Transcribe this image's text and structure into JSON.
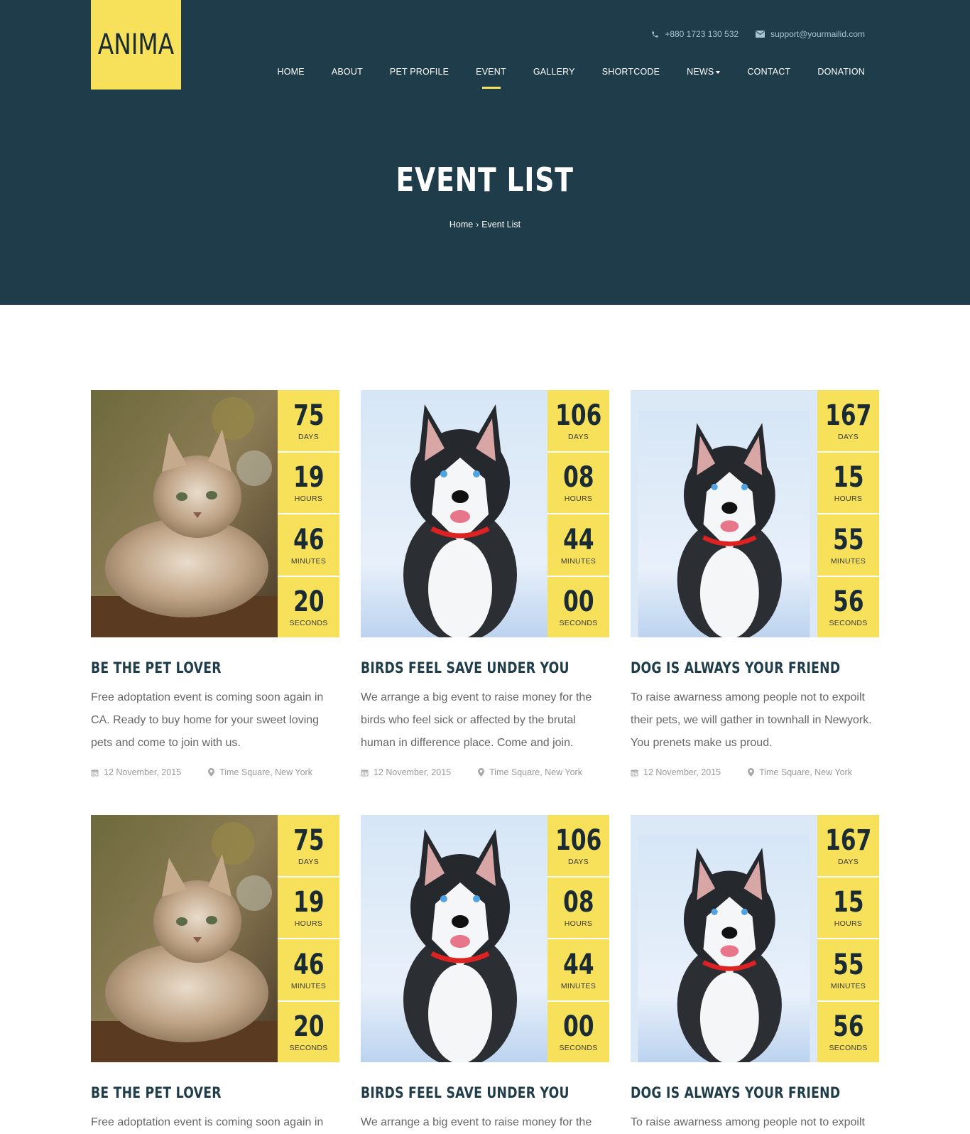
{
  "brand": {
    "logo_text": "ANIMA"
  },
  "contact": {
    "phone": "+880 1723 130 532",
    "email": "support@yourmailid.com"
  },
  "nav": {
    "items": [
      {
        "label": "HOME"
      },
      {
        "label": "ABOUT"
      },
      {
        "label": "PET PROFILE"
      },
      {
        "label": "EVENT",
        "active": true
      },
      {
        "label": "GALLERY"
      },
      {
        "label": "SHORTCODE"
      },
      {
        "label": "NEWS",
        "dropdown": true
      },
      {
        "label": "CONTACT"
      },
      {
        "label": "DONATION"
      }
    ]
  },
  "hero": {
    "title": "EVENT LIST",
    "breadcrumb": [
      "Home",
      "Event List"
    ]
  },
  "countdown_labels": {
    "days": "DAYS",
    "hours": "HOURS",
    "minutes": "MINUTES",
    "seconds": "SECONDS"
  },
  "events": [
    {
      "image": "cat-photo",
      "days": "75",
      "hours": "19",
      "minutes": "46",
      "seconds": "20",
      "title": "BE THE PET LOVER",
      "description": "Free adoptation event is coming soon again in CA. Ready to buy home for your sweet loving pets and come to join with us.",
      "date": "12 November, 2015",
      "location": "Time Square, New York"
    },
    {
      "image": "husky-puppy-photo",
      "days": "106",
      "hours": "08",
      "minutes": "44",
      "seconds": "00",
      "title": "BIRDS FEEL SAVE UNDER YOU",
      "description": "We arrange a big event to raise money for the birds who feel sick or affected by the brutal human in difference place. Come and join.",
      "date": "12 November, 2015",
      "location": "Time Square, New York"
    },
    {
      "image": "husky-snow-photo",
      "days": "167",
      "hours": "15",
      "minutes": "55",
      "seconds": "56",
      "title": "DOG IS ALWAYS YOUR FRIEND",
      "description": "To raise awarness among people not to expoilt their pets, we will gather in townhall in Newyork. You prenets make us proud.",
      "date": "12 November, 2015",
      "location": "Time Square, New York"
    },
    {
      "image": "cat-photo",
      "days": "75",
      "hours": "19",
      "minutes": "46",
      "seconds": "20",
      "title": "BE THE PET LOVER",
      "description": "Free adoptation event is coming soon again in",
      "date": "",
      "location": ""
    },
    {
      "image": "husky-puppy-photo",
      "days": "106",
      "hours": "08",
      "minutes": "44",
      "seconds": "00",
      "title": "BIRDS FEEL SAVE UNDER YOU",
      "description": "We arrange a big event to raise money for the",
      "date": "",
      "location": ""
    },
    {
      "image": "husky-snow-photo",
      "days": "167",
      "hours": "15",
      "minutes": "55",
      "seconds": "56",
      "title": "DOG IS ALWAYS YOUR FRIEND",
      "description": "To raise awarness among people not to expoilt",
      "date": "",
      "location": ""
    }
  ],
  "colors": {
    "hero_bg": "#1f3c4a",
    "accent": "#f7e15a"
  }
}
